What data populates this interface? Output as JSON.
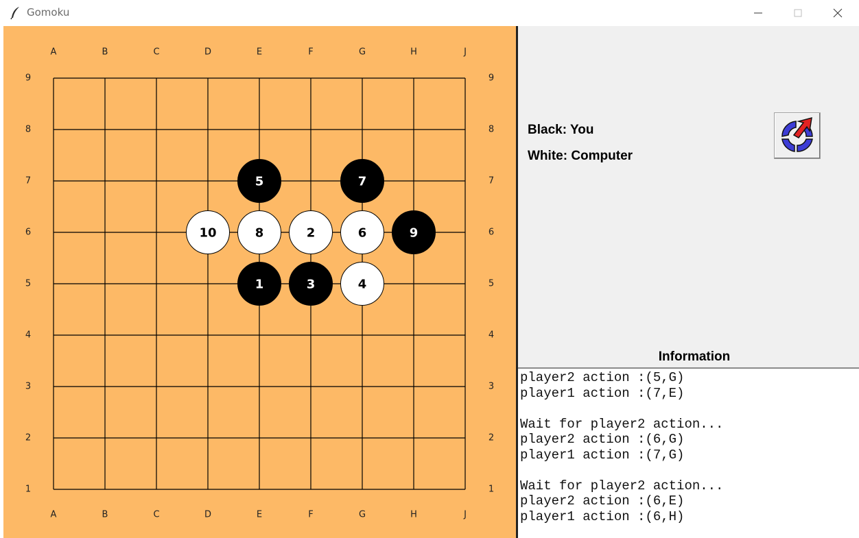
{
  "window": {
    "title": "Gomoku",
    "buttons": [
      "minimize",
      "maximize",
      "close"
    ]
  },
  "board": {
    "columns": [
      "A",
      "B",
      "C",
      "D",
      "E",
      "F",
      "G",
      "H",
      "J"
    ],
    "rows": [
      "9",
      "8",
      "7",
      "6",
      "5",
      "4",
      "3",
      "2",
      "1"
    ],
    "background": "#fdb966",
    "stones": [
      {
        "move": "1",
        "color": "black",
        "col": "E",
        "row": "5"
      },
      {
        "move": "2",
        "color": "white",
        "col": "F",
        "row": "6"
      },
      {
        "move": "3",
        "color": "black",
        "col": "F",
        "row": "5"
      },
      {
        "move": "4",
        "color": "white",
        "col": "G",
        "row": "5"
      },
      {
        "move": "5",
        "color": "black",
        "col": "E",
        "row": "7"
      },
      {
        "move": "6",
        "color": "white",
        "col": "G",
        "row": "6"
      },
      {
        "move": "7",
        "color": "black",
        "col": "G",
        "row": "7"
      },
      {
        "move": "8",
        "color": "white",
        "col": "E",
        "row": "6"
      },
      {
        "move": "9",
        "color": "black",
        "col": "H",
        "row": "6"
      },
      {
        "move": "10",
        "color": "white",
        "col": "D",
        "row": "6"
      }
    ]
  },
  "players": {
    "black": "Black: You",
    "white": "White: Computer"
  },
  "restart_icon": "restart-icon",
  "info": {
    "title": "Information",
    "log": [
      "player2 action :(5,G)",
      "player1 action :(7,E)",
      "",
      "Wait for player2 action...",
      "player2 action :(6,G)",
      "player1 action :(7,G)",
      "",
      "Wait for player2 action...",
      "player2 action :(6,E)",
      "player1 action :(6,H)"
    ]
  }
}
